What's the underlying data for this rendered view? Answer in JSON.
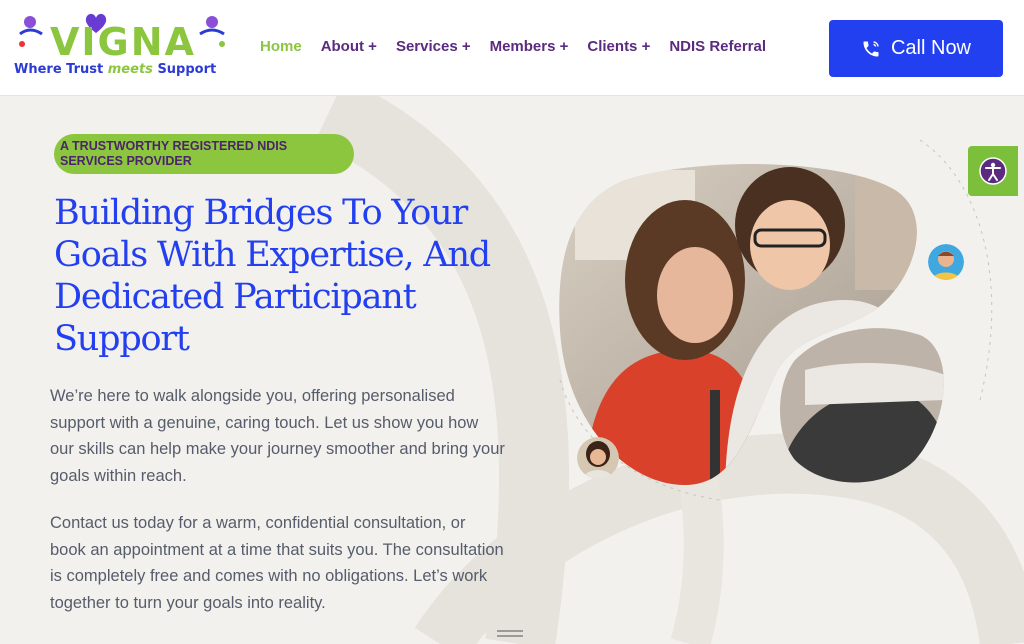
{
  "brand": {
    "logo_word": "VIGNA",
    "tagline_left": "Where Trust",
    "tagline_mid": "meets",
    "tagline_right": "Support"
  },
  "nav": {
    "items": [
      {
        "label": "Home",
        "active": true
      },
      {
        "label": "About +"
      },
      {
        "label": "Services +"
      },
      {
        "label": "Members +"
      },
      {
        "label": "Clients +"
      },
      {
        "label": "NDIS Referral"
      }
    ],
    "call_label": "Call Now"
  },
  "hero": {
    "badge": "A TRUSTWORTHY REGISTERED NDIS SERVICES PROVIDER",
    "title": "Building Bridges To Your Goals With Expertise, And Dedicated Participant Support",
    "p1": "We’re here to walk alongside you, offering personalised support with a genuine, caring touch. Let us show you how our skills can help make your journey smoother and bring your goals within reach.",
    "p2": "Contact us today for a warm, confidential consultation, or book an appointment at a time that suits you. The consultation is completely free and comes with no obligations. Let’s work together to turn your goals into reality."
  },
  "colors": {
    "accent_green": "#8cc63f",
    "brand_blue": "#2340f0",
    "brand_purple": "#5a2b7e",
    "text_grey": "#555c6b"
  },
  "icons": [
    "phone-icon",
    "accessibility-icon",
    "hero-photo",
    "avatar-man",
    "avatar-child"
  ]
}
